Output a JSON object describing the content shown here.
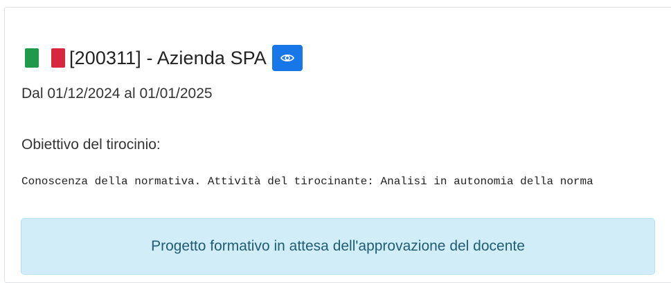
{
  "internship": {
    "title": "[200311] - Azienda SPA",
    "flag_colors": [
      "#1e9a4a",
      "#ffffff",
      "#d7263d"
    ],
    "view_icon": "eye-icon",
    "period": "Dal 01/12/2024 al 01/01/2025",
    "objective_label": "Obiettivo del tirocinio:",
    "objective_text": "Conoscenza della normativa. Attività del tirocinante: Analisi in autonomia della norma"
  },
  "status_alert": {
    "message": "Progetto formativo in attesa dell'approvazione del docente"
  },
  "colors": {
    "accent": "#1877e8",
    "alert_background": "#d1eef8",
    "alert_text": "#1f5c72"
  }
}
